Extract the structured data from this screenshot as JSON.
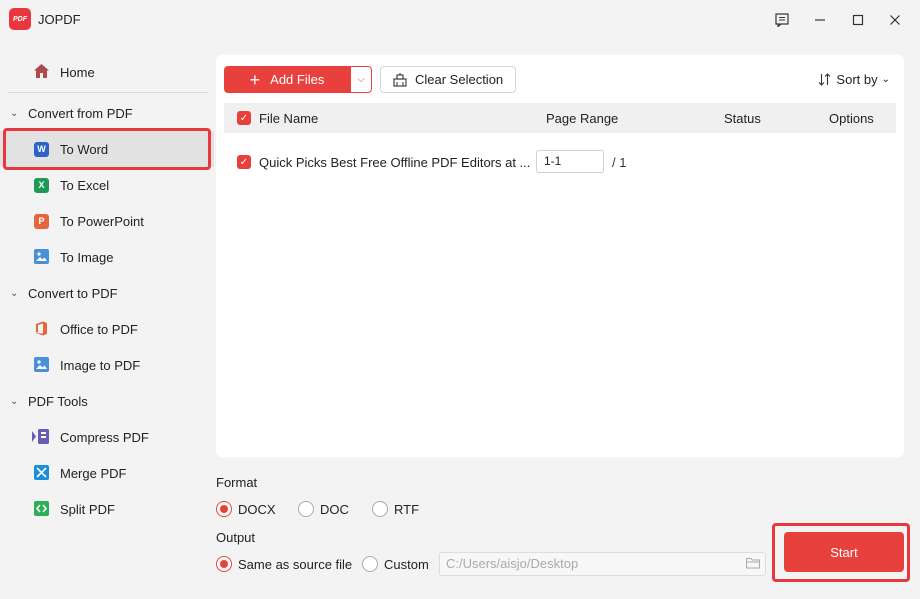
{
  "app": {
    "logo_text": "PDF",
    "title": "JOPDF"
  },
  "window_controls": [
    "feedback-icon",
    "minimize-icon",
    "maximize-icon",
    "close-icon"
  ],
  "sidebar": {
    "home": {
      "label": "Home",
      "icon": "home-icon"
    },
    "sections": [
      {
        "title": "Convert from PDF",
        "items": [
          {
            "label": "To Word",
            "icon": "word-icon",
            "badge": "W",
            "color": "#2b64c4",
            "active": true
          },
          {
            "label": "To Excel",
            "icon": "excel-icon",
            "badge": "X",
            "color": "#1f9a55"
          },
          {
            "label": "To PowerPoint",
            "icon": "powerpoint-icon",
            "badge": "P",
            "color": "#e2683c"
          },
          {
            "label": "To Image",
            "icon": "image-icon",
            "badge": "",
            "color": "#4a90d9"
          }
        ]
      },
      {
        "title": "Convert to PDF",
        "items": [
          {
            "label": "Office to PDF",
            "icon": "office-icon",
            "badge": "",
            "color": "#e2683c"
          },
          {
            "label": "Image to PDF",
            "icon": "image-icon",
            "badge": "",
            "color": "#4a90d9"
          }
        ]
      },
      {
        "title": "PDF Tools",
        "items": [
          {
            "label": "Compress PDF",
            "icon": "compress-icon",
            "badge": "",
            "color": "#6b5bb5"
          },
          {
            "label": "Merge PDF",
            "icon": "merge-icon",
            "badge": "",
            "color": "#1a8fd6"
          },
          {
            "label": "Split PDF",
            "icon": "split-icon",
            "badge": "",
            "color": "#2fae5a"
          }
        ]
      }
    ]
  },
  "toolbar": {
    "add_files": "Add Files",
    "clear_selection": "Clear Selection",
    "sort_by": "Sort by"
  },
  "table": {
    "columns": {
      "file_name": "File Name",
      "page_range": "Page Range",
      "status": "Status",
      "options": "Options"
    },
    "rows": [
      {
        "file_name": "Quick Picks Best Free Offline PDF Editors at ...",
        "page_range": "1-1",
        "total_pages": "/ 1",
        "status": "",
        "checked": true
      }
    ]
  },
  "format": {
    "label": "Format",
    "options": [
      "DOCX",
      "DOC",
      "RTF"
    ],
    "selected": "DOCX"
  },
  "output": {
    "label": "Output",
    "options": [
      "Same as source file",
      "Custom"
    ],
    "selected": "Same as source file",
    "path_placeholder": "C:/Users/aisjo/Desktop"
  },
  "start": {
    "label": "Start"
  },
  "colors": {
    "accent": "#e8413d",
    "highlight_outline": "#e8373e"
  }
}
